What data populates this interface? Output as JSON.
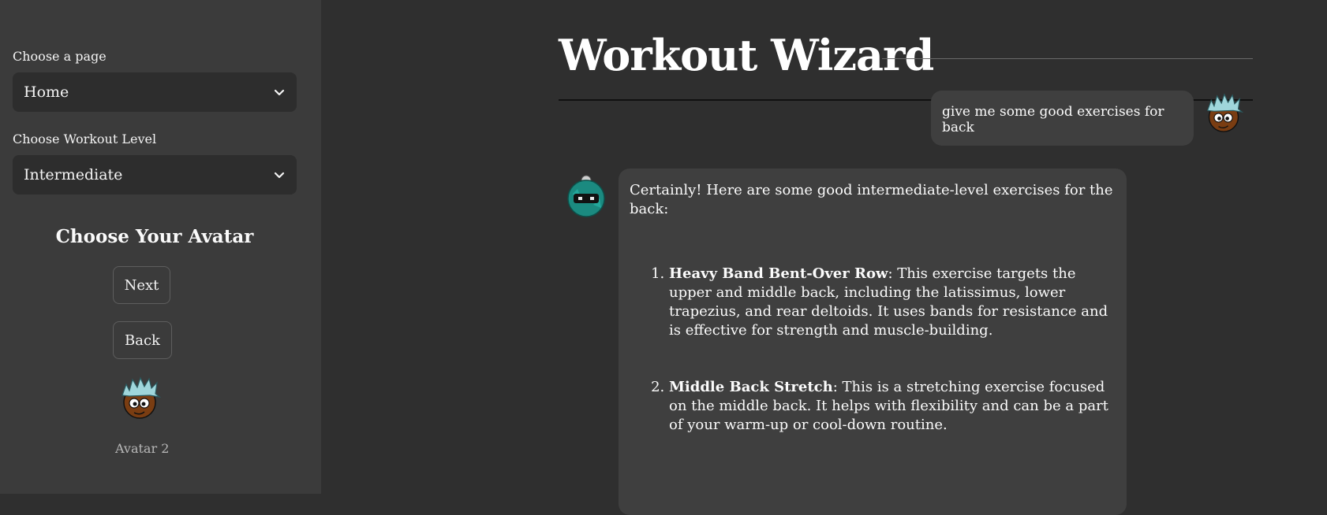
{
  "sidebar": {
    "page_label": "Choose a page",
    "page_value": "Home",
    "level_label": "Choose Workout Level",
    "level_value": "Intermediate",
    "avatar_heading": "Choose Your Avatar",
    "next_label": "Next",
    "back_label": "Back",
    "avatar_caption": "Avatar 2"
  },
  "main": {
    "title": "Workout Wizard"
  },
  "chat": {
    "user_message": "give me some good exercises for back",
    "bot_intro": "Certainly! Here are some good intermediate-level exercises for the back:",
    "exercises": [
      {
        "number": "1.",
        "name": "Heavy Band Bent-Over Row",
        "description": ": This exercise targets the upper and middle back, including the latissimus, lower trapezius, and rear deltoids. It uses bands for resistance and is effective for strength and muscle-building."
      },
      {
        "number": "2.",
        "name": "Middle Back Stretch",
        "description": ": This is a stretching exercise focused on the middle back. It helps with flexibility and can be a part of your warm-up or cool-down routine."
      }
    ]
  },
  "icons": {
    "chevron": "chevron-down-icon",
    "user_avatar": "cartoon-avatar-icon",
    "bot_avatar": "robot-avatar-icon"
  },
  "colors": {
    "sidebar_bg": "#3b3b3b",
    "main_bg": "#2f2f2f",
    "bubble_bg": "#3f3f3f"
  }
}
